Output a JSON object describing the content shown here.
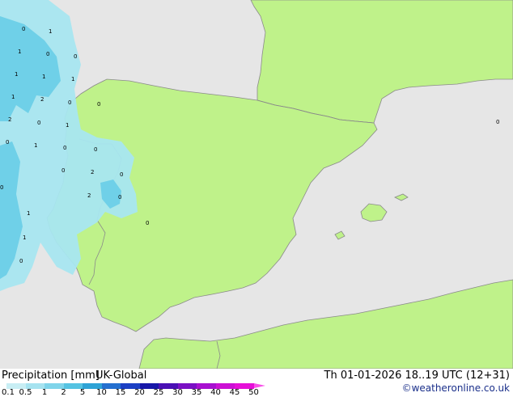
{
  "title": "Precipitation [mm]",
  "model": "UK-Global",
  "valid_time": "Th 01-01-2026 18..19 UTC (12+31)",
  "credit": "©weatheronline.co.uk",
  "colors": {
    "sea": "#e6e6e6",
    "land": "#bff28a",
    "border": "#8a8a8a",
    "rain_light": "#a8e6f0",
    "rain_mid": "#6fd0e8"
  },
  "legend": {
    "ticks": [
      "0.1",
      "0.5",
      "1",
      "2",
      "5",
      "10",
      "15",
      "20",
      "25",
      "30",
      "35",
      "40",
      "45",
      "50"
    ],
    "colors": [
      "#c8eef4",
      "#a6e3f0",
      "#7fd4ea",
      "#55c3e2",
      "#2ea3d6",
      "#2470d0",
      "#1c40c4",
      "#1818a8",
      "#4a10b4",
      "#7a10c4",
      "#a810d0",
      "#cc10d4",
      "#e610d8",
      "#f850e8"
    ]
  },
  "map_values": [
    "0",
    "1",
    "1",
    "0",
    "0",
    "1",
    "1",
    "1",
    "1",
    "2",
    "0",
    "2",
    "0",
    "1",
    "0",
    "0",
    "1",
    "0",
    "0",
    "0",
    "2",
    "0",
    "0",
    "2",
    "0",
    "1",
    "0",
    "1",
    "0",
    "0"
  ]
}
